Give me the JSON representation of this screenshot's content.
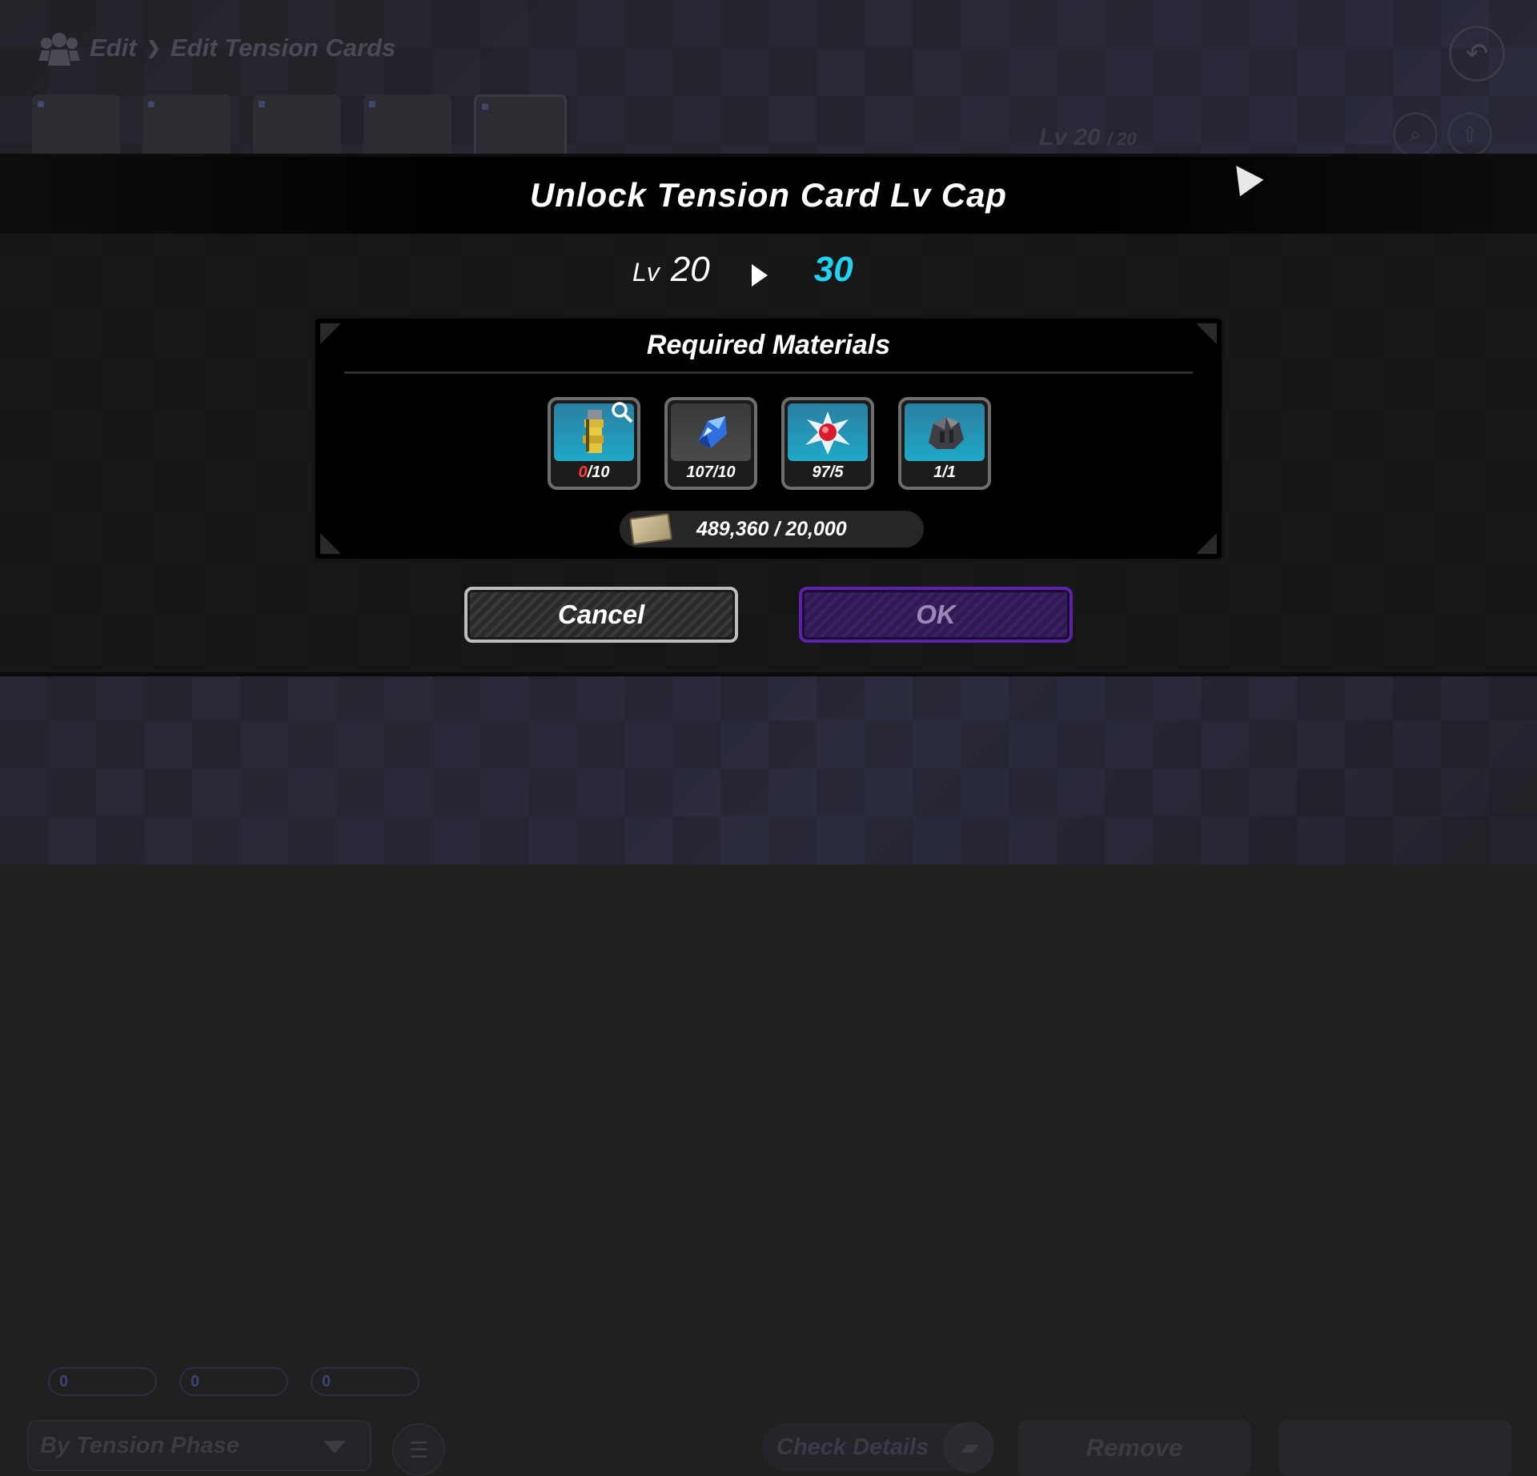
{
  "breadcrumb": {
    "parent": "Edit",
    "separator": "❯",
    "current": "Edit Tension Cards"
  },
  "top": {
    "level_text": "Lv 20",
    "level_max": "/ 20"
  },
  "dialog": {
    "title": "Unlock Tension Card Lv Cap",
    "lv_label": "Lv",
    "lv_from": "20",
    "lv_to": "30",
    "materials_title": "Required Materials",
    "materials": [
      {
        "icon": "gold-scroll-icon",
        "have": "0",
        "need": "/10",
        "short": true,
        "style": "blue"
      },
      {
        "icon": "blue-gem-icon",
        "have": "107",
        "need": "/10",
        "short": false,
        "style": "gray"
      },
      {
        "icon": "red-orb-burst-icon",
        "have": "97",
        "need": "/5",
        "short": false,
        "style": "blue"
      },
      {
        "icon": "dark-ore-icon",
        "have": "1",
        "need": "/1",
        "short": false,
        "style": "blue"
      }
    ],
    "money": "489,360 / 20,000",
    "cancel_label": "Cancel",
    "ok_label": "OK"
  },
  "bottom": {
    "sort_label": "By Tension Phase",
    "check_details": "Check Details",
    "remove": "Remove",
    "phase_tags": [
      "0",
      "0",
      "0"
    ]
  },
  "colors": {
    "level_target": "#22d2f2",
    "short_count": "#ff3a3a",
    "ok_border": "#5e22a8"
  }
}
